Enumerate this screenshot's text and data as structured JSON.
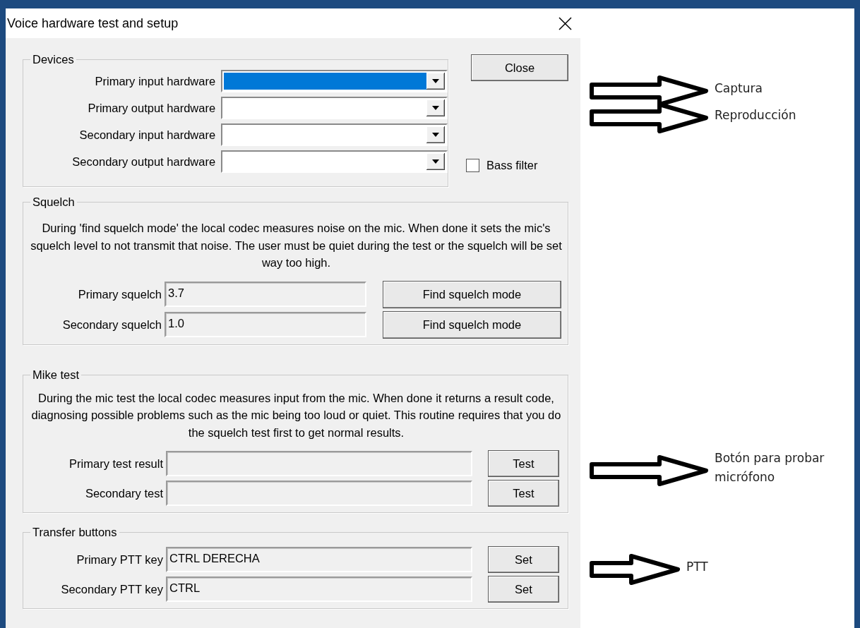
{
  "window": {
    "title": "Voice hardware test and setup"
  },
  "devices": {
    "legend": "Devices",
    "combos": [
      {
        "label": "Primary input hardware",
        "selected": true
      },
      {
        "label": "Primary output hardware",
        "selected": false
      },
      {
        "label": "Secondary input hardware",
        "selected": false
      },
      {
        "label": "Secondary output hardware",
        "selected": false
      }
    ],
    "close_button": "Close",
    "bass_filter": {
      "label": "Bass filter",
      "checked": false
    }
  },
  "groups": [
    {
      "kind": "squelch",
      "legend": "Squelch",
      "description": "During 'find squelch mode' the local codec measures noise on the mic. When done it sets the mic's squelch level to not transmit that noise. The user must be quiet during the test or the squelch will be set way too high.",
      "rows": [
        {
          "label": "Primary squelch",
          "value": "3.7",
          "button": "Find squelch mode"
        },
        {
          "label": "Secondary squelch",
          "value": "1.0",
          "button": "Find squelch mode"
        }
      ]
    },
    {
      "kind": "mike",
      "legend": "Mike test",
      "description": "During the mic test the local codec measures input from the mic.  When done it returns a result code, diagnosing possible problems such as the mic being too loud or quiet.  This routine requires that you do the squelch test first to get normal results.",
      "rows": [
        {
          "label": "Primary test result",
          "button": "Test"
        },
        {
          "label": "Secondary test",
          "button": "Test"
        }
      ]
    },
    {
      "kind": "transfer",
      "legend": "Transfer buttons",
      "rows": [
        {
          "label": "Primary PTT key",
          "value": "CTRL DERECHA",
          "button": "Set"
        },
        {
          "label": "Secondary PTT key",
          "value": "CTRL",
          "button": "Set"
        }
      ]
    }
  ],
  "annotations": [
    {
      "text": "Captura"
    },
    {
      "text": "Reproducción"
    },
    {
      "text": "Botón para probar micrófono"
    },
    {
      "text": "PTT"
    }
  ]
}
